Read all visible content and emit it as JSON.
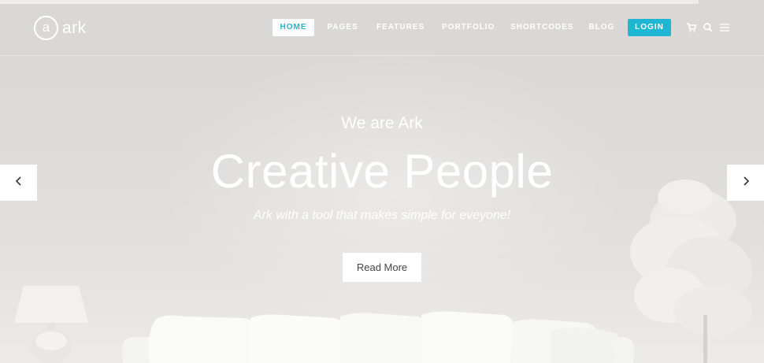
{
  "header": {
    "logo_mark": "a",
    "logo_text": "ark",
    "nav": {
      "home": "HOME",
      "pages": "PAGES",
      "features": "FEATURES",
      "portfolio": "PORTFOLIO",
      "shortcodes": "SHORTCODES",
      "blog": "BLOG",
      "login": "LOGIN"
    },
    "icons": [
      "cart-icon",
      "search-icon",
      "menu-icon"
    ]
  },
  "hero": {
    "tagline": "We are Ark",
    "headline": "Creative People",
    "subtitle": "Ark with a tool that makes  simple for eveyone!",
    "button": "Read More"
  },
  "slider": {
    "prev_icon": "chevron-left-icon",
    "next_icon": "chevron-right-icon"
  },
  "colors": {
    "accent": "#1fb6d4",
    "background": "#dcdad8",
    "text_light": "#ffffff"
  }
}
